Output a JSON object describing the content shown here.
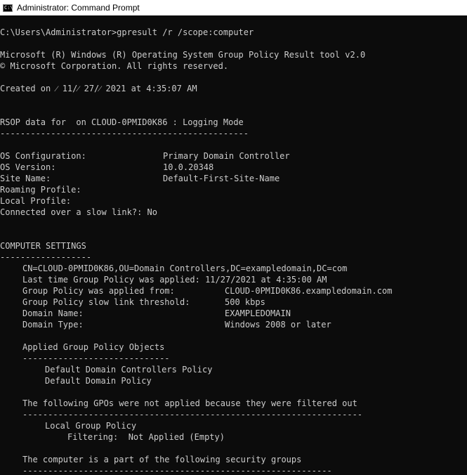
{
  "window": {
    "title": "Administrator: Command Prompt",
    "icon": "cmd-icon",
    "icon_glyph": "C:\\"
  },
  "console": {
    "text_color": "#cccccc",
    "background": "#0c0c0c",
    "lines": [
      [
        {
          "t": "C:\\Users\\Administrator>gpresult /r /scope:computer",
          "c": 0
        }
      ],
      [],
      [
        {
          "t": "Microsoft (R) Windows (R) Operating System Group Policy Result tool v2.0",
          "c": 0
        }
      ],
      [
        {
          "t": "© Microsoft Corporation. All rights reserved.",
          "c": 0
        }
      ],
      [],
      [
        {
          "t": "Created on ⁄ 11/⁄ 27/⁄ 2021 at 4:35:07 AM",
          "c": 0
        }
      ],
      [],
      [],
      [
        {
          "t": "RSOP data for  on CLOUD-0PMID0K86 : Logging Mode",
          "c": 0
        }
      ],
      [
        {
          "t": "-------------------------------------------------",
          "c": 0
        }
      ],
      [],
      [
        {
          "t": "OS Configuration:",
          "c": 0
        },
        {
          "t": "Primary Domain Controller",
          "c": 29
        }
      ],
      [
        {
          "t": "OS Version:",
          "c": 0
        },
        {
          "t": "10.0.20348",
          "c": 29
        }
      ],
      [
        {
          "t": "Site Name:",
          "c": 0
        },
        {
          "t": "Default-First-Site-Name",
          "c": 29
        }
      ],
      [
        {
          "t": "Roaming Profile:",
          "c": 0
        }
      ],
      [
        {
          "t": "Local Profile:",
          "c": 0
        }
      ],
      [
        {
          "t": "Connected over a slow link?: No",
          "c": 0
        }
      ],
      [],
      [],
      [
        {
          "t": "COMPUTER SETTINGS",
          "c": 0
        }
      ],
      [
        {
          "t": "------------------",
          "c": 0
        }
      ],
      [
        {
          "t": "CN=CLOUD-0PMID0K86,OU=Domain Controllers,DC=exampledomain,DC=com",
          "c": 4
        }
      ],
      [
        {
          "t": "Last time Group Policy was applied: 11/27/2021 at 4:35:00 AM",
          "c": 4
        }
      ],
      [
        {
          "t": "Group Policy was applied from:",
          "c": 4
        },
        {
          "t": "CLOUD-0PMID0K86.exampledomain.com",
          "c": 40
        }
      ],
      [
        {
          "t": "Group Policy slow link threshold:",
          "c": 4
        },
        {
          "t": "500 kbps",
          "c": 40
        }
      ],
      [
        {
          "t": "Domain Name:",
          "c": 4
        },
        {
          "t": "EXAMPLEDOMAIN",
          "c": 40
        }
      ],
      [
        {
          "t": "Domain Type:",
          "c": 4
        },
        {
          "t": "Windows 2008 or later",
          "c": 40
        }
      ],
      [],
      [
        {
          "t": "Applied Group Policy Objects",
          "c": 4
        }
      ],
      [
        {
          "t": "-----------------------------",
          "c": 4
        }
      ],
      [
        {
          "t": "Default Domain Controllers Policy",
          "c": 8
        }
      ],
      [
        {
          "t": "Default Domain Policy",
          "c": 8
        }
      ],
      [],
      [
        {
          "t": "The following GPOs were not applied because they were filtered out",
          "c": 4
        }
      ],
      [
        {
          "t": "-------------------------------------------------------------------",
          "c": 4
        }
      ],
      [
        {
          "t": "Local Group Policy",
          "c": 8
        }
      ],
      [
        {
          "t": "Filtering:  Not Applied (Empty)",
          "c": 12
        }
      ],
      [],
      [
        {
          "t": "The computer is a part of the following security groups",
          "c": 4
        }
      ],
      [
        {
          "t": "-------------------------------------------------------------",
          "c": 4
        }
      ]
    ]
  }
}
